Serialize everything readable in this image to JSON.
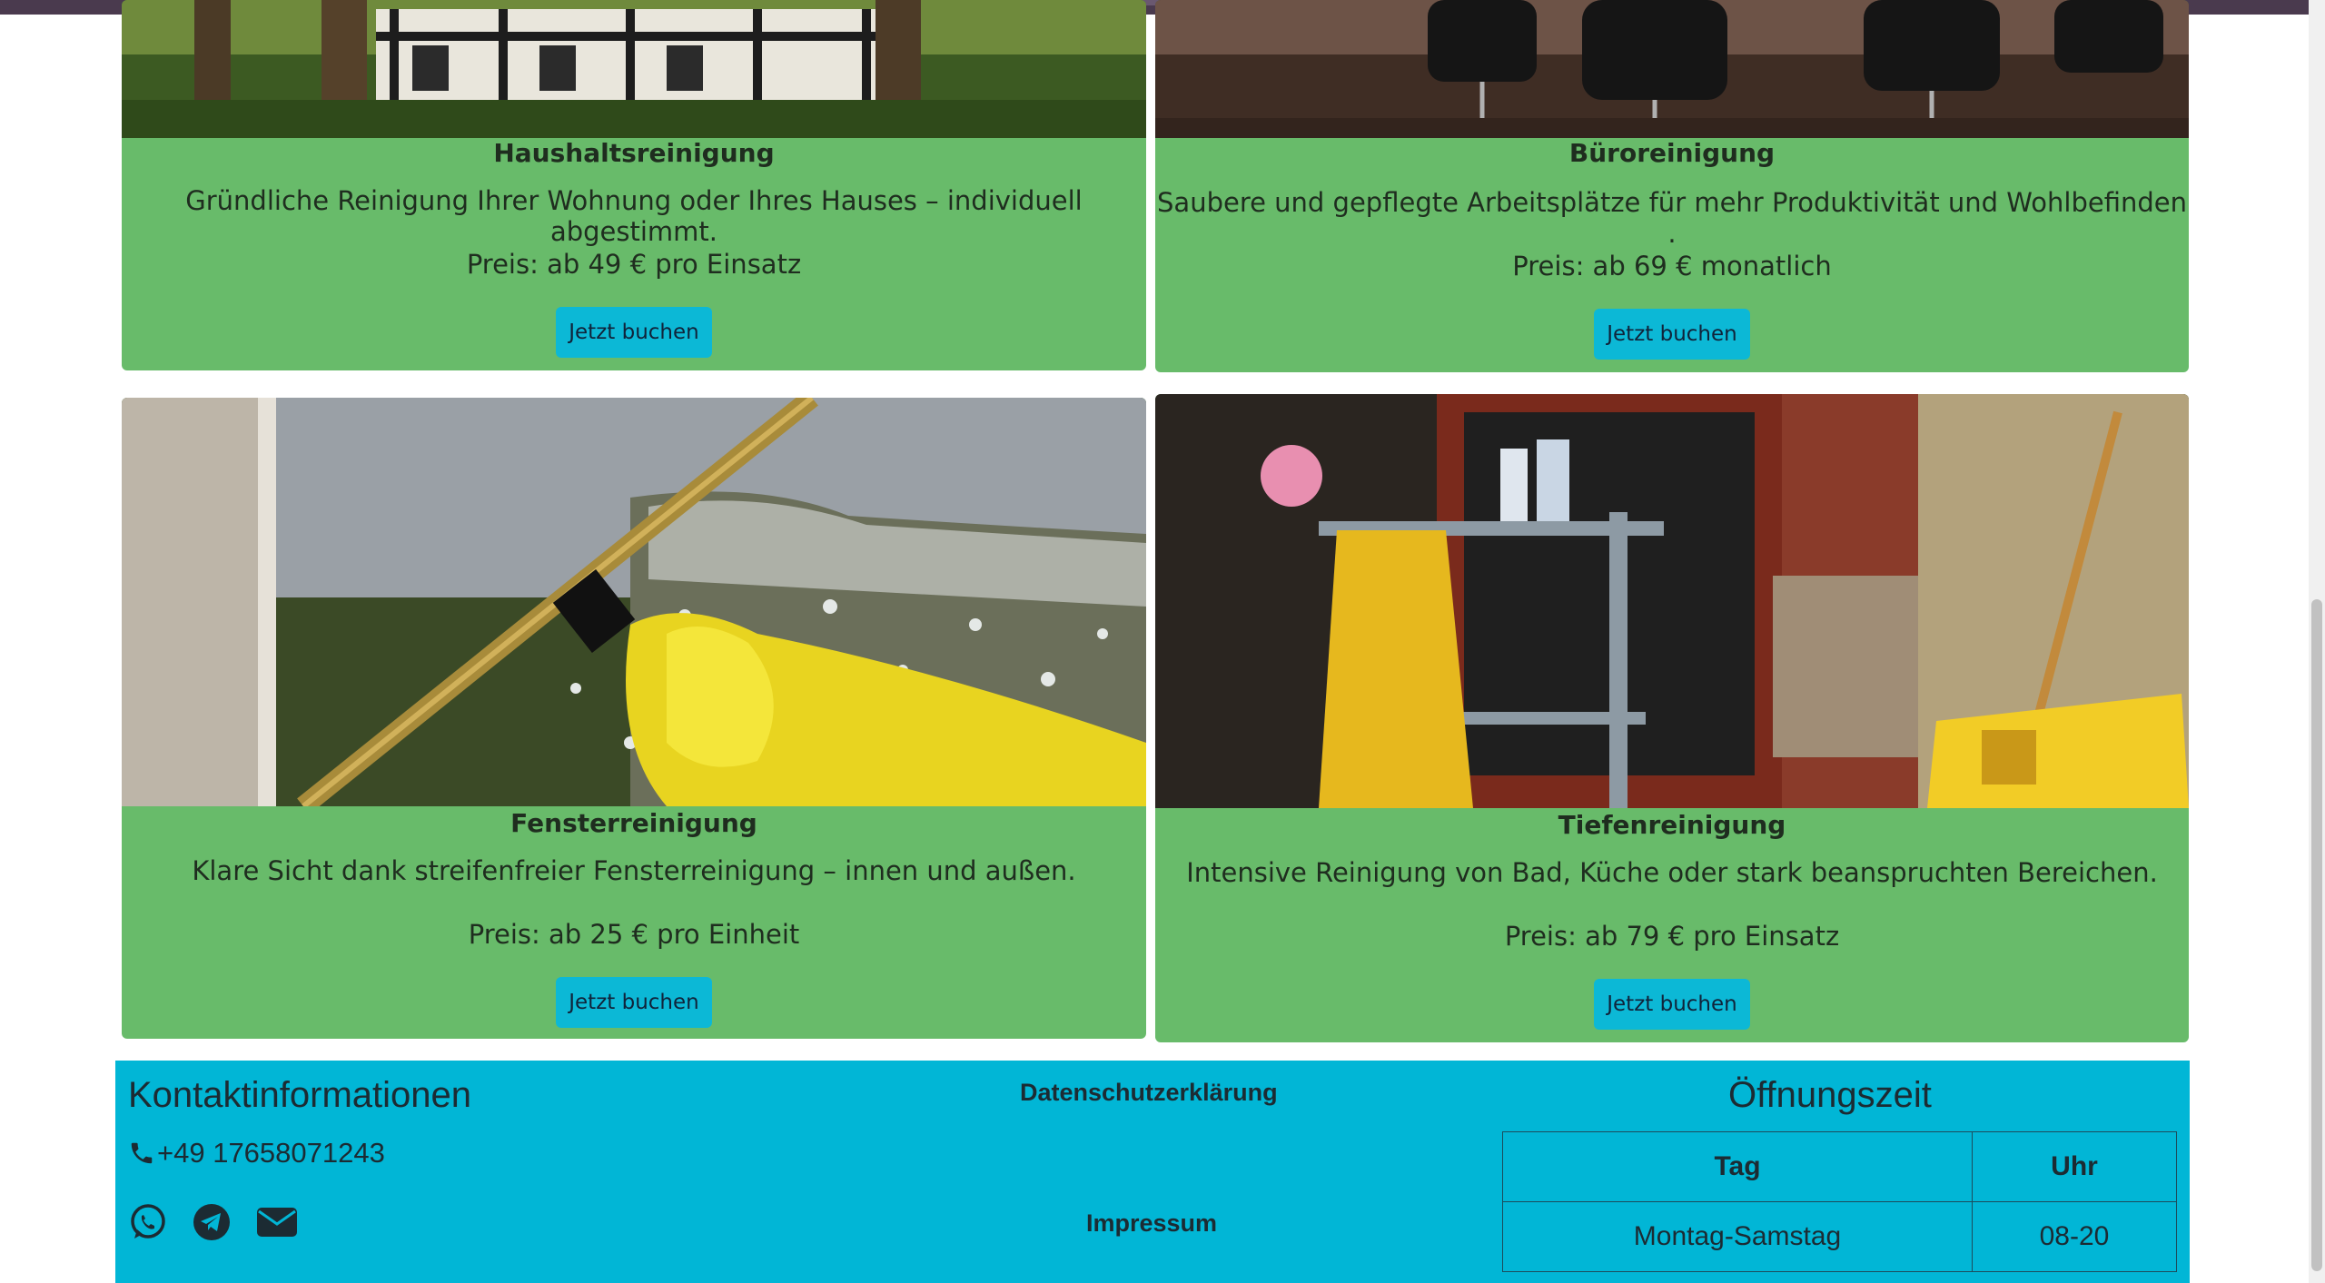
{
  "cards": [
    {
      "title": "Haushaltsreinigung",
      "description": "Gründliche Reinigung Ihrer Wohnung oder Ihres Hauses – individuell abgestimmt.",
      "price": "Preis: ab 49 € pro Einsatz",
      "button": "Jetzt buchen",
      "image": "half-timbered-house-photo"
    },
    {
      "title": "Büroreinigung",
      "description": "Saubere und gepflegte Arbeitsplätze für mehr Produktivität und Wohlbefinden .",
      "price": "Preis: ab 69 € monatlich",
      "button": "Jetzt buchen",
      "image": "office-chairs-photo"
    },
    {
      "title": "Fensterreinigung",
      "description": "Klare Sicht dank streifenfreier Fensterreinigung – innen und außen.",
      "price": "Preis: ab 25 € pro Einheit",
      "button": "Jetzt buchen",
      "image": "window-squeegee-photo"
    },
    {
      "title": "Tiefenreinigung",
      "description": "Intensive Reinigung von Bad, Küche oder stark beanspruchten Bereichen.",
      "price": "Preis: ab 79 € pro Einsatz",
      "button": "Jetzt buchen",
      "image": "cleaning-cart-photo"
    }
  ],
  "footer": {
    "contact_title": "Kontaktinformationen",
    "phone": "+49 17658071243",
    "icons": [
      "phone-icon",
      "whatsapp-icon",
      "telegram-icon",
      "email-icon"
    ],
    "privacy_link": "Datenschutzerklärung",
    "imprint_link": "Impressum",
    "hours_title": "Öffnungszeit",
    "hours_table": {
      "headers": [
        "Tag",
        "Uhr"
      ],
      "rows": [
        [
          "Montag-Samstag",
          "08-20"
        ]
      ]
    }
  },
  "colors": {
    "card_bg": "#68bb6a",
    "button_bg": "#0cb8d6",
    "footer_bg": "#01b6d6"
  }
}
